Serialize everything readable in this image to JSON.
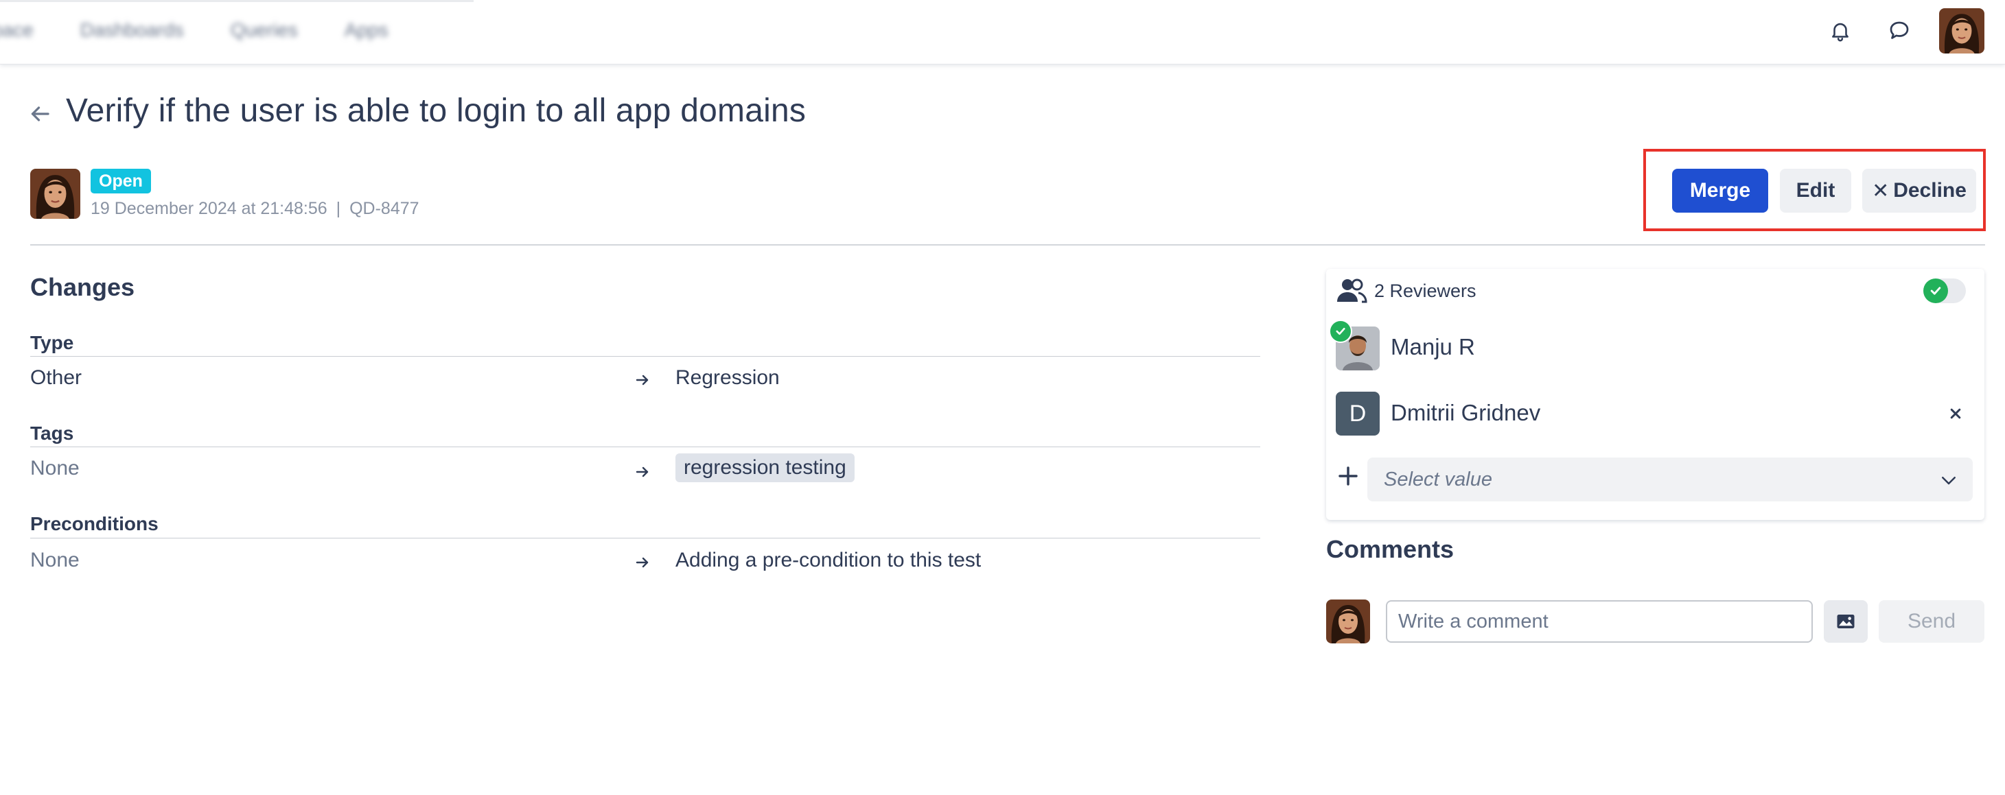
{
  "topbar": {
    "nav_items": [
      "pace",
      "Dashboards",
      "Queries",
      "Apps"
    ]
  },
  "header": {
    "title": "Verify if the user is able to login to all app domains",
    "status": "Open",
    "timestamp": "19 December 2024 at 21:48:56",
    "separator": "|",
    "key": "QD-8477"
  },
  "actions": {
    "merge_label": "Merge",
    "edit_label": "Edit",
    "decline_label": "Decline"
  },
  "changes": {
    "title": "Changes",
    "fields": [
      {
        "label": "Type",
        "old": "Other",
        "new": "Regression"
      },
      {
        "label": "Tags",
        "old": "None",
        "new": "regression testing"
      },
      {
        "label": "Preconditions",
        "old": "None",
        "new": "Adding a pre-condition to this test"
      }
    ]
  },
  "reviewers": {
    "count_label": "2 Reviewers",
    "people": [
      {
        "name": "Manju R",
        "approved": true
      },
      {
        "name": "Dmitrii Gridnev",
        "initial": "D",
        "approved": false
      }
    ],
    "select_placeholder": "Select value"
  },
  "comments": {
    "title": "Comments",
    "input_placeholder": "Write a comment",
    "send_label": "Send"
  },
  "colors": {
    "primary": "#1f4fd1",
    "status_badge": "#12c3e0",
    "approved": "#22b15a",
    "highlight_border": "#e8322a"
  },
  "icons": [
    "bell-icon",
    "chat-bubble-icon",
    "back-arrow-icon",
    "people-icon",
    "check-icon",
    "arrow-right-icon",
    "close-icon",
    "plus-icon",
    "chevron-down-icon",
    "image-icon"
  ]
}
